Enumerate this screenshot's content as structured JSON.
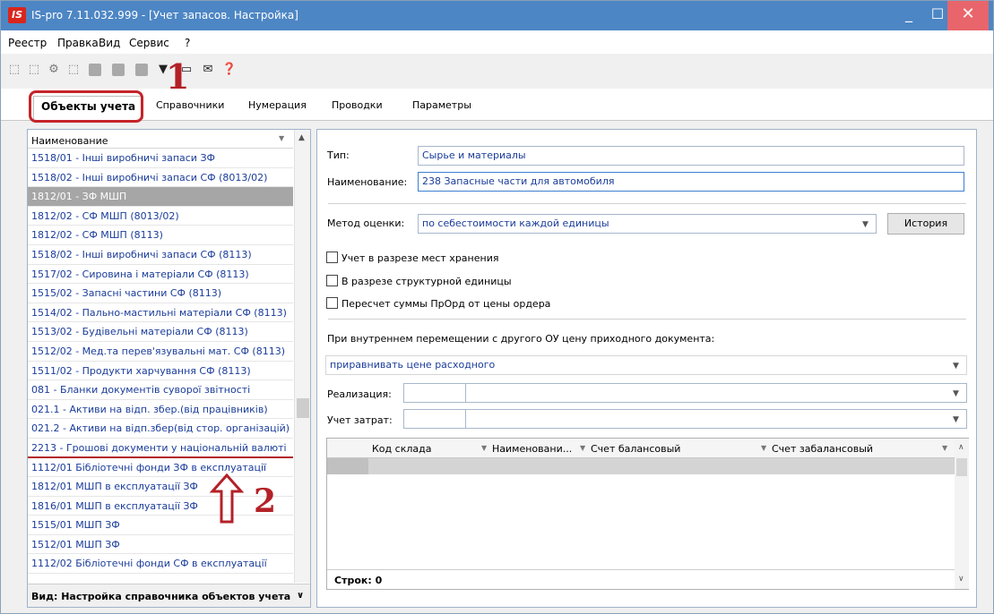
{
  "window": {
    "app_icon": "IS",
    "title": "IS-pro 7.11.032.999 - [Учет запасов. Настройка]",
    "controls": {
      "minimize": "_",
      "maximize": "☐",
      "close": "✕"
    }
  },
  "menu": [
    "Реестр",
    "Правка",
    "Вид",
    "Сервис",
    "?"
  ],
  "tabs": [
    "Объекты учета",
    "Справочники",
    "Нумерация",
    "Проводки",
    "Параметры"
  ],
  "callouts": {
    "one": "1",
    "two": "2"
  },
  "left_panel": {
    "header": "Наименование",
    "rows": [
      "1518/01 - Інші виробничі запаси ЗФ",
      "1518/02 - Інші виробничі запаси СФ (8013/02)",
      "1812/01 - ЗФ МШП",
      "1812/02 - СФ МШП (8013/02)",
      "1812/02 - СФ МШП (8113)",
      "1518/02 - Інші виробничі запаси СФ (8113)",
      "1517/02 - Сировина і матеріали СФ (8113)",
      "1515/02 - Запасні частини СФ (8113)",
      "1514/02 - Пально-мастильні матеріали СФ (8113)",
      "1513/02 - Будівельні матеріали СФ (8113)",
      "1512/02 - Мед.та перев'язувальні мат. СФ (8113)",
      "1511/02 - Продукти харчування СФ (8113)",
      "081 - Бланки документів суворої звітності",
      "021.1 - Активи на відп. збер.(від працівників)",
      "021.2 - Активи на відп.збер(від стор. організацій)",
      "2213 - Грошові документи у національній валюті",
      "1112/01 Бібліотечні фонди ЗФ в експлуатації",
      "1812/01 МШП в експлуатації  ЗФ",
      "1816/01 МШП в експлуатації ЗФ",
      "1515/01  МШП ЗФ",
      "1512/01   МШП ЗФ",
      "1112/02 Бібліотечні фонди СФ в експлуатації"
    ],
    "selected_index": 2,
    "footer": "Вид: Настройка справочника объектов учета"
  },
  "right_panel": {
    "type_label": "Тип:",
    "type_value": "Сырье и материалы",
    "name_label": "Наименование:",
    "name_value": "238 Запасные части для автомобиля",
    "method_label": "Метод оценки:",
    "method_value": "по себестоимости каждой единицы",
    "history_button": "История",
    "checkboxes": [
      "Учет в разрезе мест хранения",
      "В разрезе структурной единицы",
      "Пересчет суммы ПрОрд от цены ордера"
    ],
    "transfer_label": "При внутреннем перемещении с другого ОУ цену приходного документа:",
    "transfer_value": "приравнивать цене расходного",
    "realization_label": "Реализация:",
    "cost_label": "Учет затрат:",
    "grid_columns": [
      "Код склада",
      "Наименовани...",
      "Счет балансовый",
      "Счет забалансовый"
    ],
    "rows_count": "Строк: 0"
  }
}
